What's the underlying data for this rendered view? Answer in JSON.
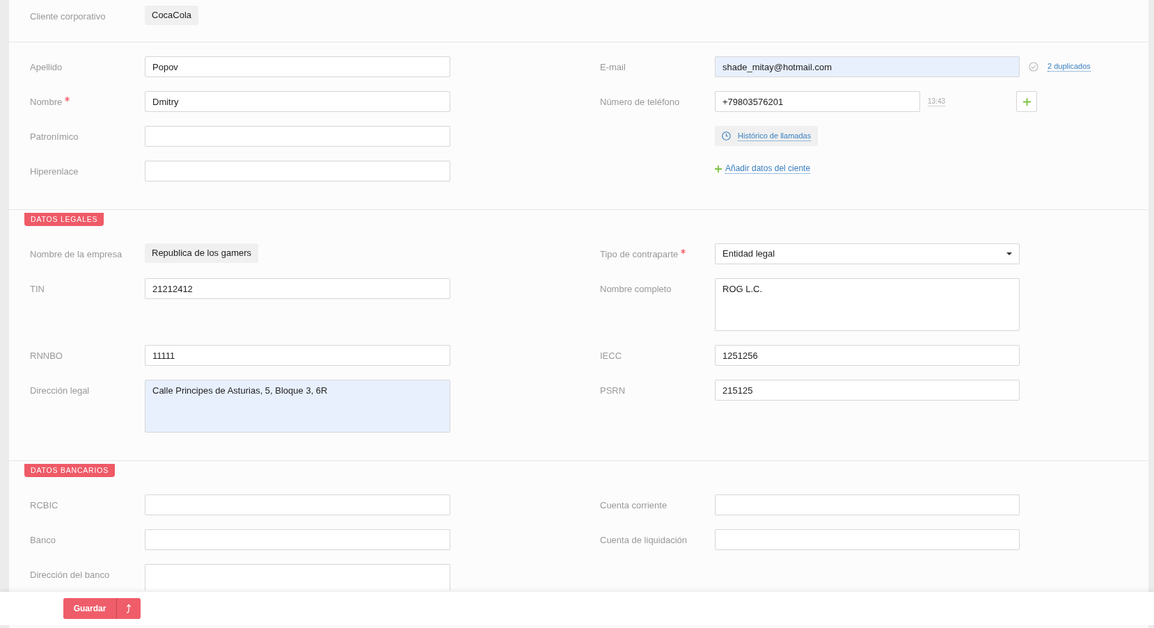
{
  "corporate_client": {
    "label": "Cliente corporativo",
    "value": "CocaCola"
  },
  "sections": [
    {
      "rows": [
        {
          "left": {
            "kind": "input",
            "label": "Apellido",
            "required": false,
            "highlighted": false,
            "value": "Popov"
          },
          "right": {
            "kind": "email",
            "label": "E-mail",
            "required": false,
            "highlighted": true,
            "value": "shade_mitay@hotmail.com",
            "duplicates": "2 duplicados"
          }
        },
        {
          "left": {
            "kind": "input",
            "label": "Nombre",
            "required": true,
            "highlighted": false,
            "value": "Dmitry"
          },
          "right": {
            "kind": "phone",
            "label": "Número de teléfono",
            "required": false,
            "highlighted": false,
            "value": "+79803576201",
            "time": "13:43"
          }
        },
        {
          "left": {
            "kind": "input",
            "label": "Patronímico",
            "required": false,
            "highlighted": false
          },
          "right": {
            "kind": "history",
            "text": "Histórico de llamadas"
          }
        },
        {
          "left": {
            "kind": "input",
            "label": "Hiperenlace",
            "required": false,
            "highlighted": false
          },
          "right": {
            "kind": "add_link",
            "text": "Añadir datos del ciente"
          }
        }
      ]
    },
    {
      "badge": "DATOS LEGALES",
      "rows": [
        {
          "left": {
            "kind": "chip",
            "label": "Nombre de la empresa",
            "required": false,
            "value": "Republica de los gamers"
          },
          "right": {
            "kind": "select",
            "label": "Tipo de contraparte",
            "required": true,
            "highlighted": false,
            "value": "Entidad legal"
          }
        },
        {
          "left": {
            "kind": "input",
            "label": "TIN",
            "required": false,
            "highlighted": false,
            "value": "21212412"
          },
          "right": {
            "kind": "textarea",
            "label": "Nombre completo",
            "required": false,
            "highlighted": false,
            "value": "ROG L.C."
          }
        },
        {
          "left": {
            "kind": "input",
            "label": "RNNBO",
            "required": false,
            "highlighted": false,
            "value": "11111"
          },
          "right": {
            "kind": "input",
            "label": "IECC",
            "required": false,
            "highlighted": false,
            "value": "1251256"
          }
        },
        {
          "left": {
            "kind": "textarea",
            "label": "Dirección legal",
            "required": false,
            "highlighted": true,
            "value": "Calle Principes de Asturias, 5, Bloque 3, 6R"
          },
          "right": {
            "kind": "input",
            "label": "PSRN",
            "required": false,
            "highlighted": false,
            "value": "215125"
          }
        }
      ]
    },
    {
      "badge": "DATOS BANCARIOS",
      "rows": [
        {
          "left": {
            "kind": "input",
            "label": "RCBIC",
            "required": false,
            "highlighted": false
          },
          "right": {
            "kind": "input",
            "label": "Cuenta corriente",
            "required": false,
            "highlighted": false
          }
        },
        {
          "left": {
            "kind": "input",
            "label": "Banco",
            "required": false,
            "highlighted": false
          },
          "right": {
            "kind": "input",
            "label": "Cuenta de liquidación",
            "required": false,
            "highlighted": false
          }
        },
        {
          "left": {
            "kind": "textarea",
            "label": "Dirección del banco",
            "required": false,
            "highlighted": false
          }
        }
      ]
    }
  ],
  "footer": {
    "save": "Guardar"
  }
}
